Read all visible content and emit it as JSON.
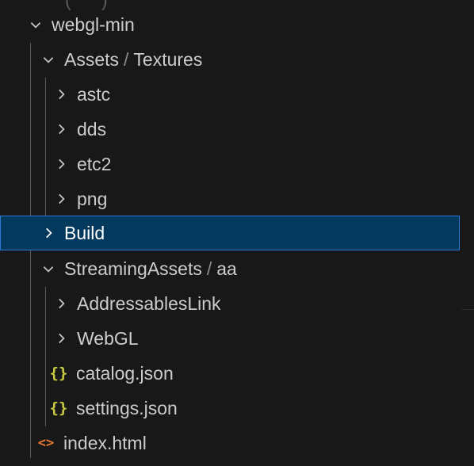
{
  "explorer": {
    "root": {
      "label": "webgl-min",
      "expanded": true
    },
    "assets_folder": {
      "label_parts": [
        "Assets",
        "Textures"
      ],
      "separator": "/",
      "expanded": true
    },
    "assets_children": [
      {
        "label": "astc",
        "expanded": false
      },
      {
        "label": "dds",
        "expanded": false
      },
      {
        "label": "etc2",
        "expanded": false
      },
      {
        "label": "png",
        "expanded": false
      }
    ],
    "build_folder": {
      "label": "Build",
      "expanded": false,
      "selected": true
    },
    "streaming_folder": {
      "label_parts": [
        "StreamingAssets",
        "aa"
      ],
      "separator": "/",
      "expanded": true
    },
    "streaming_children": [
      {
        "label": "AddressablesLink",
        "expanded": false
      },
      {
        "label": "WebGL",
        "expanded": false
      }
    ],
    "json_files": [
      {
        "label": "catalog.json",
        "icon": "json-braces-icon",
        "icon_glyph": "{}"
      },
      {
        "label": "settings.json",
        "icon": "json-braces-icon",
        "icon_glyph": "{}"
      }
    ],
    "html_file": {
      "label": "index.html",
      "icon": "html-code-icon",
      "icon_glyph": "<>"
    }
  },
  "colors": {
    "background": "#181818",
    "text": "#cccccc",
    "selection_bg": "#04395e",
    "selection_border": "#2b79d8",
    "json_icon": "#cbcb41",
    "html_icon": "#e37933",
    "indent_guide": "#585858"
  }
}
